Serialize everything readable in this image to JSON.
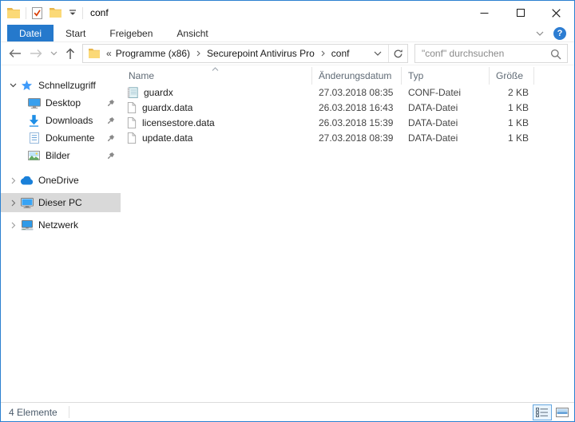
{
  "titlebar": {
    "title": "conf"
  },
  "ribbon": {
    "tabs": [
      {
        "label": "Datei",
        "active": true
      },
      {
        "label": "Start",
        "active": false
      },
      {
        "label": "Freigeben",
        "active": false
      },
      {
        "label": "Ansicht",
        "active": false
      }
    ],
    "help_glyph": "?"
  },
  "addressbar": {
    "overflow_glyph": "«",
    "crumbs": [
      "Programme (x86)",
      "Securepoint Antivirus Pro",
      "conf"
    ],
    "search_placeholder": "\"conf\" durchsuchen"
  },
  "sidebar": {
    "quick_access": {
      "label": "Schnellzugriff",
      "items": [
        {
          "label": "Desktop"
        },
        {
          "label": "Downloads"
        },
        {
          "label": "Dokumente"
        },
        {
          "label": "Bilder"
        }
      ]
    },
    "groups": [
      {
        "label": "OneDrive"
      },
      {
        "label": "Dieser PC",
        "selected": true
      },
      {
        "label": "Netzwerk"
      }
    ]
  },
  "files": {
    "columns": [
      "Name",
      "Änderungsdatum",
      "Typ",
      "Größe"
    ],
    "rows": [
      {
        "name": "guardx",
        "modified": "27.03.2018 08:35",
        "type": "CONF-Datei",
        "size": "2 KB"
      },
      {
        "name": "guardx.data",
        "modified": "26.03.2018 16:43",
        "type": "DATA-Datei",
        "size": "1 KB"
      },
      {
        "name": "licensestore.data",
        "modified": "26.03.2018 15:39",
        "type": "DATA-Datei",
        "size": "1 KB"
      },
      {
        "name": "update.data",
        "modified": "27.03.2018 08:39",
        "type": "DATA-Datei",
        "size": "1 KB"
      }
    ]
  },
  "statusbar": {
    "count": "4 Elemente"
  },
  "colors": {
    "accent": "#2579cc",
    "window_border": "#2a80d0",
    "selected_bg": "#d9d9d9"
  }
}
